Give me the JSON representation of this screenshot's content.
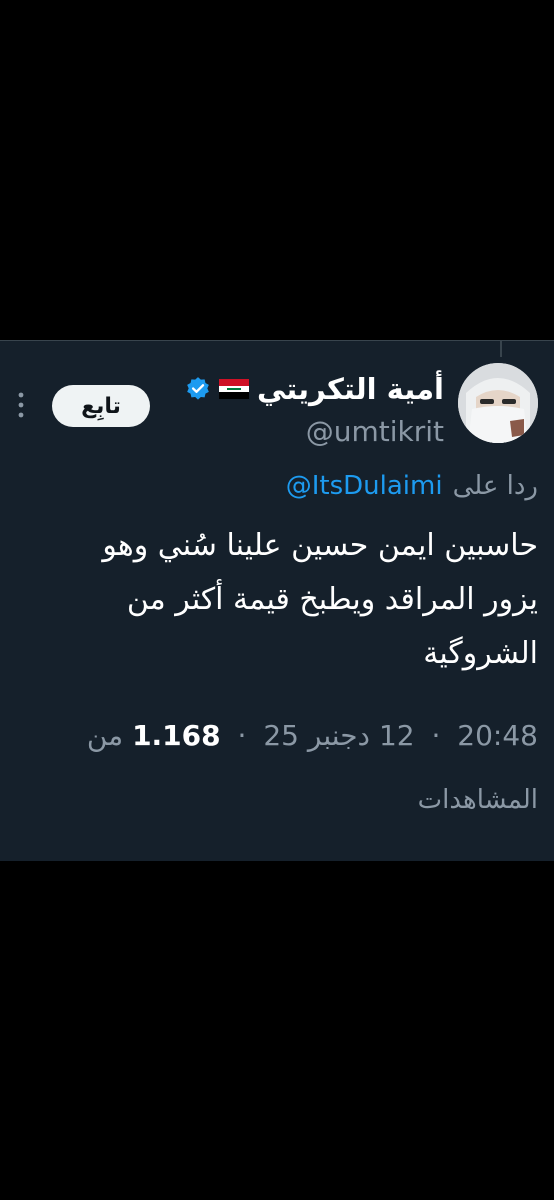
{
  "colors": {
    "page_background": "#000000",
    "card_background": "#15202b",
    "text_primary": "#ffffff",
    "text_secondary": "#8b98a5",
    "link": "#1d9bf0",
    "verified_badge": "#1d9bf0",
    "follow_button_bg": "#eff3f4"
  },
  "author": {
    "display_name": "أمية التكريتي",
    "flag_icon": "iraq-flag-icon",
    "verified_icon": "verified-badge-icon",
    "handle": "@umtikrit",
    "avatar_icon": "avatar"
  },
  "actions": {
    "follow_label": "تابِع",
    "more_icon": "more-vertical-icon"
  },
  "reply": {
    "prefix": "ردا على",
    "handle": "@ItsDulaimi"
  },
  "tweet": {
    "text": "حاسبين ايمن حسين علينا سُني وهو\nيزور المراقد ويطبخ قيمة أكثر من\nالشروگية"
  },
  "meta": {
    "time": "20:48",
    "date": "12 دجنبر 25",
    "separator": "·",
    "views_count": "1.168",
    "views_prefix": "من",
    "views_label": "المشاهدات"
  }
}
